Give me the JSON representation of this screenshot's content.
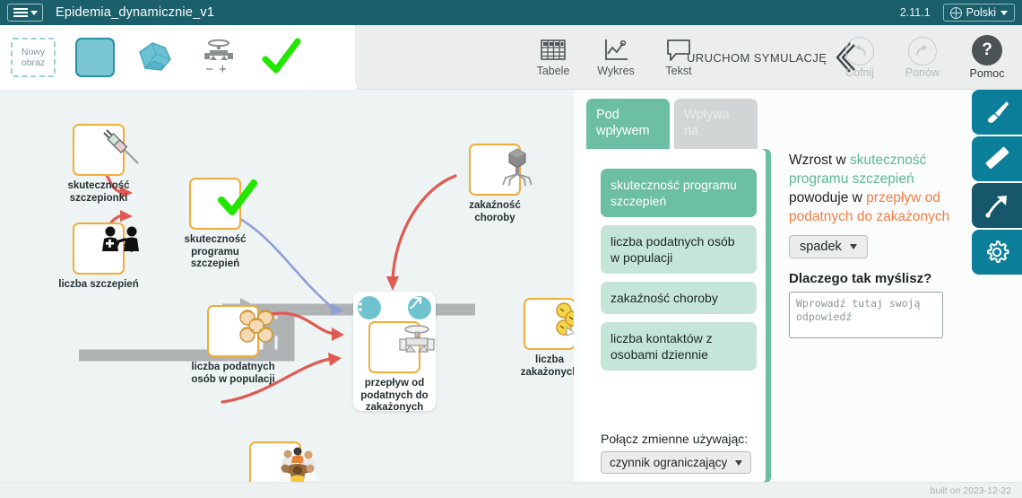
{
  "titlebar": {
    "menu_icon": "hamburger-icon",
    "doc_title": "Epidemia_dynamicznie_v1",
    "version": "2.11.1",
    "language": "Polski",
    "language_icon": "globe-icon"
  },
  "toolbar": {
    "new_image_label": "Nowy\nobraz",
    "new_image_line1": "Nowy",
    "new_image_line2": "obraz",
    "stock_icon": "stock-square-icon",
    "cloud_icon": "cloud-icon",
    "flow_icon": "flow-valve-icon",
    "check_icon": "green-check-icon",
    "expander_icon": "chevron-down-icon",
    "items": [
      {
        "label": "Tabele",
        "icon": "table-icon"
      },
      {
        "label": "Wykres",
        "icon": "chart-icon"
      },
      {
        "label": "Tekst",
        "icon": "text-bubble-icon"
      }
    ],
    "run_simulation": "URUCHOM SYMULACJĘ",
    "run_simulation_icon": "double-chevron-left-icon",
    "undo": "Cofnij",
    "undo_icon": "undo-arrow-icon",
    "redo": "Ponów",
    "redo_icon": "redo-arrow-icon",
    "help": "Pomoc",
    "help_icon": "question-mark-icon"
  },
  "canvas": {
    "nodes": [
      {
        "label": "skuteczność\nszczepionki",
        "line1": "skuteczność",
        "line2": "szczepionki",
        "icon": "syringe-icon"
      },
      {
        "label": "liczba szczepień",
        "line1": "liczba szczepień",
        "line2": "",
        "icon": "vaccination-people-icon"
      },
      {
        "label": "skuteczność\nprogramu\nszczepień",
        "line1": "skuteczność",
        "line2": "programu",
        "line3": "szczepień",
        "icon": "green-check-icon"
      },
      {
        "label": "zakaźność\nchoroby",
        "line1": "zakaźność",
        "line2": "choroby",
        "icon": "virus-phage-icon"
      },
      {
        "label": "liczba podatnych\nosób w populacji",
        "line1": "liczba podatnych",
        "line2": "osób w populacji",
        "icon": "susceptible-people-icon"
      },
      {
        "label": "przepływ od\npodatnych do\nzakażonych",
        "line1": "przepływ od",
        "line2": "podatnych do",
        "line3": "zakażonych",
        "icon": "valve-icon"
      },
      {
        "label": "liczba\nzakażonych",
        "line1": "liczba",
        "line2": "zakażonych",
        "icon": "infected-people-icon"
      },
      {
        "label": "",
        "line1": "",
        "line2": "",
        "icon": "meeting-people-icon"
      }
    ],
    "flow_card_menu_icon": "three-dots-icon",
    "flow_card_graph_icon": "arrow-graph-icon"
  },
  "relation_panel": {
    "tabs": [
      {
        "label": "Pod\nwpływem",
        "line1": "Pod",
        "line2": "wpływem",
        "active": true
      },
      {
        "label": "Wpływa\nna",
        "line1": "Wpływa",
        "line2": "na",
        "active": false
      }
    ],
    "variables": [
      {
        "label": "skuteczność programu szczepień",
        "selected": true
      },
      {
        "label": "liczba podatnych osób w populacji",
        "selected": false
      },
      {
        "label": "zakaźność choroby",
        "selected": false
      },
      {
        "label": "liczba kontaktów z osobami dziennie",
        "selected": false
      }
    ],
    "connect_label": "Połącz zmienne używając:",
    "connect_value": "czynnik ograniczający"
  },
  "statement": {
    "part1": "Wzrost w ",
    "cause": "skuteczność programu szczepień",
    "part2": " powoduje w ",
    "effect": "przepływ od podatnych do zakażonych",
    "direction_value": "spadek",
    "why_label": "Dlaczego tak myślisz?",
    "why_placeholder": "Wprowadź tutaj swoją odpowiedź",
    "why_value": ""
  },
  "right_tools": [
    {
      "icon": "paintbrush-icon",
      "active": false
    },
    {
      "icon": "ruler-icon",
      "active": false
    },
    {
      "icon": "arrow-link-icon",
      "active": true
    },
    {
      "icon": "gear-icon",
      "active": false
    }
  ],
  "statusbar": {
    "build": "built on 2023-12-22"
  },
  "colors": {
    "titlebar": "#1b5f6b",
    "accent_teal": "#0b7f99",
    "node_border": "#f0ad3c",
    "panel_green": "#6cbfa3",
    "panel_green_light": "#c5e5d9",
    "cause_text": "#5cb793",
    "effect_text": "#ef7f45",
    "canvas_bg": "#eef3f3"
  }
}
